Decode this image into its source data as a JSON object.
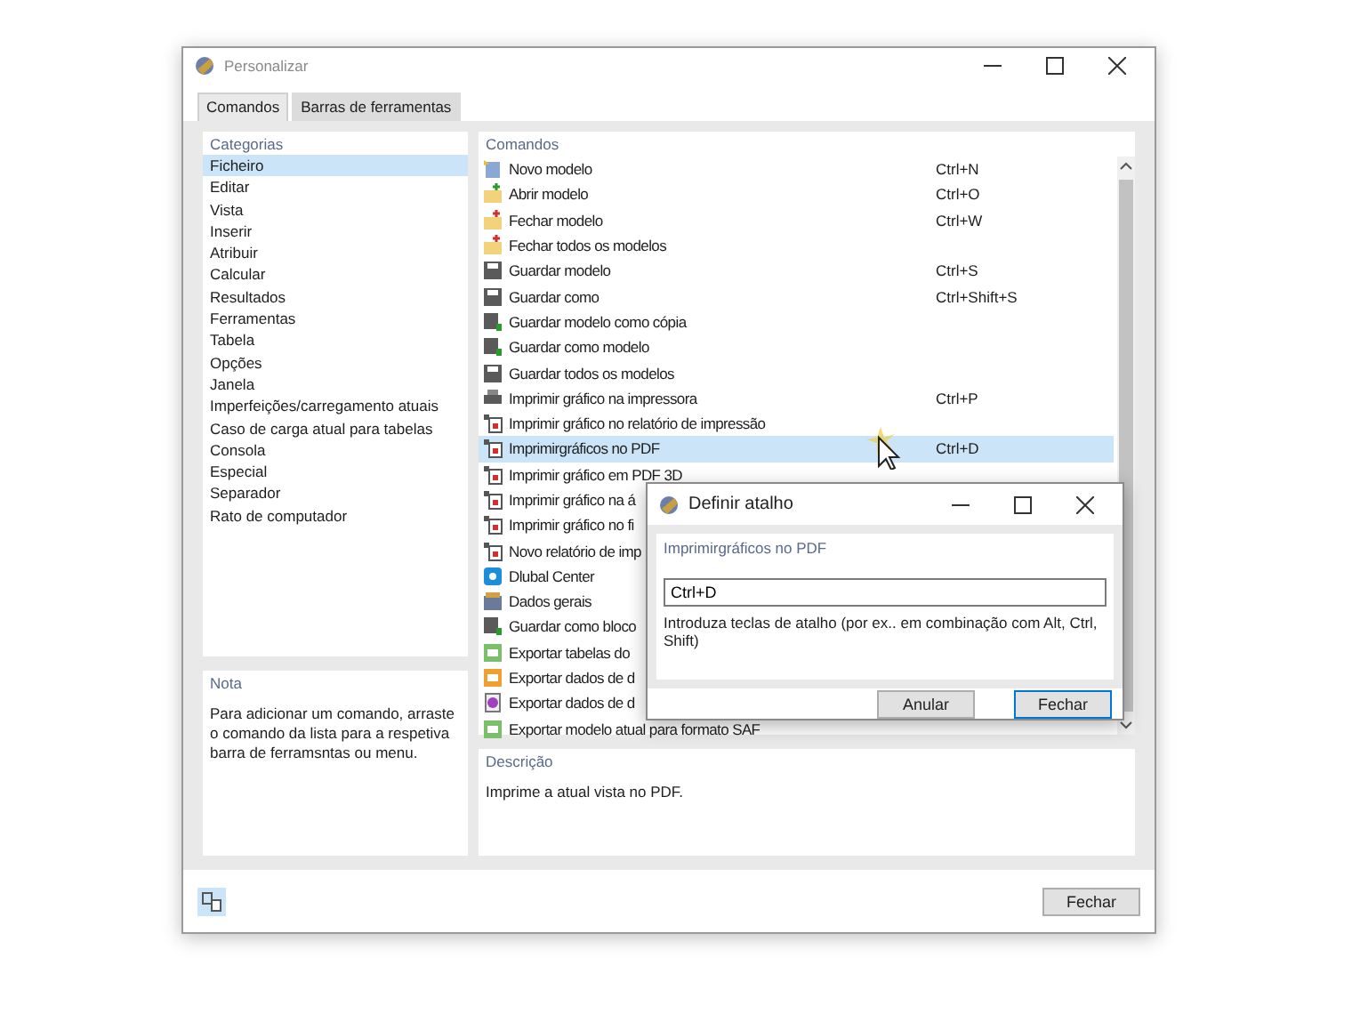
{
  "window": {
    "title": "Personalizar"
  },
  "tabs": [
    {
      "label": "Comandos",
      "selected": true
    },
    {
      "label": "Barras de ferramentas",
      "selected": false
    }
  ],
  "categories": {
    "heading": "Categorias",
    "items": [
      {
        "label": "Ficheiro",
        "selected": true
      },
      {
        "label": "Editar",
        "selected": false
      },
      {
        "label": "Vista",
        "selected": false
      },
      {
        "label": "Inserir",
        "selected": false
      },
      {
        "label": "Atribuir",
        "selected": false
      },
      {
        "label": "Calcular",
        "selected": false
      },
      {
        "label": "Resultados",
        "selected": false
      },
      {
        "label": "Ferramentas",
        "selected": false
      },
      {
        "label": "Tabela",
        "selected": false
      },
      {
        "label": "Opções",
        "selected": false
      },
      {
        "label": "Janela",
        "selected": false
      },
      {
        "label": "Imperfeições/carregamento atuais",
        "selected": false
      },
      {
        "label": "Caso de carga atual para tabelas",
        "selected": false
      },
      {
        "label": "Consola",
        "selected": false
      },
      {
        "label": "Especial",
        "selected": false
      },
      {
        "label": "Separador",
        "selected": false
      },
      {
        "label": "Rato de computador",
        "selected": false
      }
    ]
  },
  "note": {
    "heading": "Nota",
    "text": "Para adicionar um comando, arraste o comando da lista para a respetiva barra de ferramsntas ou menu."
  },
  "commands": {
    "heading": "Comandos",
    "items": [
      {
        "label": "Novo modelo",
        "shortcut": "Ctrl+N",
        "selected": false
      },
      {
        "label": "Abrir modelo",
        "shortcut": "Ctrl+O",
        "selected": false
      },
      {
        "label": "Fechar modelo",
        "shortcut": "Ctrl+W",
        "selected": false
      },
      {
        "label": "Fechar todos os modelos",
        "selected": false
      },
      {
        "label": "Guardar modelo",
        "shortcut": "Ctrl+S",
        "selected": false
      },
      {
        "label": "Guardar como",
        "shortcut": "Ctrl+Shift+S",
        "selected": false
      },
      {
        "label": "Guardar modelo como cópia",
        "selected": false
      },
      {
        "label": "Guardar como modelo",
        "selected": false
      },
      {
        "label": "Guardar todos os modelos",
        "selected": false
      },
      {
        "label": "Imprimir gráfico na impressora",
        "shortcut": "Ctrl+P",
        "selected": false
      },
      {
        "label": "Imprimir gráfico no relatório de impressão",
        "selected": false
      },
      {
        "label": "Imprimirgráficos no PDF",
        "shortcut": "Ctrl+D",
        "selected": true
      },
      {
        "label": "Imprimir gráfico em PDF 3D",
        "selected": false
      },
      {
        "label": "Imprimir gráfico na á",
        "selected": false
      },
      {
        "label": "Imprimir gráfico no fi",
        "selected": false
      },
      {
        "label": "Novo relatório de imp",
        "selected": false
      },
      {
        "label": "Dlubal Center",
        "selected": false
      },
      {
        "label": "Dados gerais",
        "selected": false
      },
      {
        "label": "Guardar como bloco",
        "selected": false
      },
      {
        "label": "Exportar tabelas do",
        "selected": false
      },
      {
        "label": "Exportar dados de d",
        "selected": false
      },
      {
        "label": "Exportar dados de d",
        "selected": false
      },
      {
        "label": "Exportar modelo atual para formato SAF",
        "selected": false
      }
    ]
  },
  "description": {
    "heading": "Descrição",
    "text": "Imprime a atual vista no PDF."
  },
  "footer": {
    "button": "Fechar"
  },
  "dialog": {
    "title": "Definir atalho",
    "command": "Imprimirgráficos no PDF",
    "value": "Ctrl+D",
    "hint": "Introduza teclas de atalho (por ex.. em combinação com Alt, Ctrl, Shift)",
    "buttons": [
      {
        "label": "Anular",
        "default": false
      },
      {
        "label": "Fechar",
        "default": true
      }
    ]
  }
}
